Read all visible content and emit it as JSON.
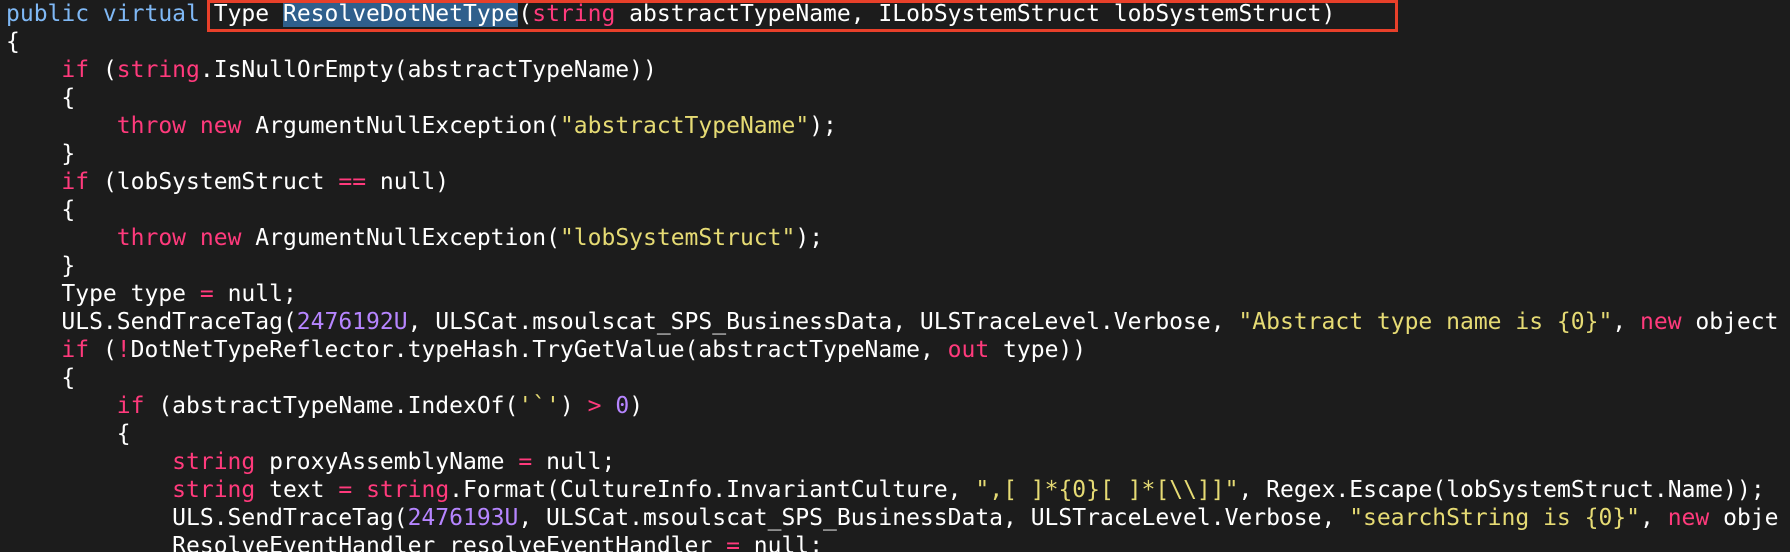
{
  "colors": {
    "background": "#1c1c1c",
    "keyword": "#ff3a7c",
    "declaration_keyword": "#7fb8f5",
    "string_literal": "#e6db74",
    "number_literal": "#b685ff",
    "plain": "#ffffff",
    "selection": "#2f5f8c",
    "highlight_box": "#e8402a"
  },
  "code_lines": [
    [
      {
        "t": "public virtual",
        "k": "decl"
      },
      {
        "t": " Type ",
        "k": "plain"
      },
      {
        "t": "ResolveDotNetType",
        "k": "sel"
      },
      {
        "t": "(",
        "k": "plain"
      },
      {
        "t": "string",
        "k": "type"
      },
      {
        "t": " abstractTypeName, ILobSystemStruct lobSystemStruct)",
        "k": "plain"
      }
    ],
    [
      {
        "t": "{",
        "k": "plain"
      }
    ],
    [
      {
        "t": "    ",
        "k": "plain"
      },
      {
        "t": "if",
        "k": "kw"
      },
      {
        "t": " (",
        "k": "plain"
      },
      {
        "t": "string",
        "k": "type"
      },
      {
        "t": ".IsNullOrEmpty(abstractTypeName))",
        "k": "plain"
      }
    ],
    [
      {
        "t": "    {",
        "k": "plain"
      }
    ],
    [
      {
        "t": "        ",
        "k": "plain"
      },
      {
        "t": "throw",
        "k": "kw"
      },
      {
        "t": " ",
        "k": "plain"
      },
      {
        "t": "new",
        "k": "kw"
      },
      {
        "t": " ArgumentNullException(",
        "k": "plain"
      },
      {
        "t": "\"abstractTypeName\"",
        "k": "str"
      },
      {
        "t": ");",
        "k": "plain"
      }
    ],
    [
      {
        "t": "    }",
        "k": "plain"
      }
    ],
    [
      {
        "t": "    ",
        "k": "plain"
      },
      {
        "t": "if",
        "k": "kw"
      },
      {
        "t": " (lobSystemStruct ",
        "k": "plain"
      },
      {
        "t": "==",
        "k": "op"
      },
      {
        "t": " null)",
        "k": "plain"
      }
    ],
    [
      {
        "t": "    {",
        "k": "plain"
      }
    ],
    [
      {
        "t": "        ",
        "k": "plain"
      },
      {
        "t": "throw",
        "k": "kw"
      },
      {
        "t": " ",
        "k": "plain"
      },
      {
        "t": "new",
        "k": "kw"
      },
      {
        "t": " ArgumentNullException(",
        "k": "plain"
      },
      {
        "t": "\"lobSystemStruct\"",
        "k": "str"
      },
      {
        "t": ");",
        "k": "plain"
      }
    ],
    [
      {
        "t": "    }",
        "k": "plain"
      }
    ],
    [
      {
        "t": "    Type type ",
        "k": "plain"
      },
      {
        "t": "=",
        "k": "op"
      },
      {
        "t": " null;",
        "k": "plain"
      }
    ],
    [
      {
        "t": "    ULS.SendTraceTag(",
        "k": "plain"
      },
      {
        "t": "2476192U",
        "k": "num"
      },
      {
        "t": ", ULSCat.msoulscat_SPS_BusinessData, ULSTraceLevel.Verbose, ",
        "k": "plain"
      },
      {
        "t": "\"Abstract type name is {0}\"",
        "k": "str"
      },
      {
        "t": ", ",
        "k": "plain"
      },
      {
        "t": "new",
        "k": "kw"
      },
      {
        "t": " object",
        "k": "plain"
      }
    ],
    [
      {
        "t": "    ",
        "k": "plain"
      },
      {
        "t": "if",
        "k": "kw"
      },
      {
        "t": " (",
        "k": "plain"
      },
      {
        "t": "!",
        "k": "op"
      },
      {
        "t": "DotNetTypeReflector.typeHash.TryGetValue(abstractTypeName, ",
        "k": "plain"
      },
      {
        "t": "out",
        "k": "kw"
      },
      {
        "t": " type))",
        "k": "plain"
      }
    ],
    [
      {
        "t": "    {",
        "k": "plain"
      }
    ],
    [
      {
        "t": "        ",
        "k": "plain"
      },
      {
        "t": "if",
        "k": "kw"
      },
      {
        "t": " (abstractTypeName.IndexOf(",
        "k": "plain"
      },
      {
        "t": "'`'",
        "k": "str"
      },
      {
        "t": ") ",
        "k": "plain"
      },
      {
        "t": ">",
        "k": "op"
      },
      {
        "t": " ",
        "k": "plain"
      },
      {
        "t": "0",
        "k": "num"
      },
      {
        "t": ")",
        "k": "plain"
      }
    ],
    [
      {
        "t": "        {",
        "k": "plain"
      }
    ],
    [
      {
        "t": "            ",
        "k": "plain"
      },
      {
        "t": "string",
        "k": "type"
      },
      {
        "t": " proxyAssemblyName ",
        "k": "plain"
      },
      {
        "t": "=",
        "k": "op"
      },
      {
        "t": " null;",
        "k": "plain"
      }
    ],
    [
      {
        "t": "            ",
        "k": "plain"
      },
      {
        "t": "string",
        "k": "type"
      },
      {
        "t": " text ",
        "k": "plain"
      },
      {
        "t": "=",
        "k": "op"
      },
      {
        "t": " ",
        "k": "plain"
      },
      {
        "t": "string",
        "k": "type"
      },
      {
        "t": ".Format(CultureInfo.InvariantCulture, ",
        "k": "plain"
      },
      {
        "t": "\",[ ]*{0}[ ]*[\\\\]]\"",
        "k": "str"
      },
      {
        "t": ", Regex.Escape(lobSystemStruct.Name));",
        "k": "plain"
      }
    ],
    [
      {
        "t": "            ULS.SendTraceTag(",
        "k": "plain"
      },
      {
        "t": "2476193U",
        "k": "num"
      },
      {
        "t": ", ULSCat.msoulscat_SPS_BusinessData, ULSTraceLevel.Verbose, ",
        "k": "plain"
      },
      {
        "t": "\"searchString is {0}\"",
        "k": "str"
      },
      {
        "t": ", ",
        "k": "plain"
      },
      {
        "t": "new",
        "k": "kw"
      },
      {
        "t": " obje",
        "k": "plain"
      }
    ],
    [
      {
        "t": "            ResolveEventHandler resolveEventHandler ",
        "k": "plain"
      },
      {
        "t": "=",
        "k": "op"
      },
      {
        "t": " null;",
        "k": "plain"
      }
    ]
  ]
}
